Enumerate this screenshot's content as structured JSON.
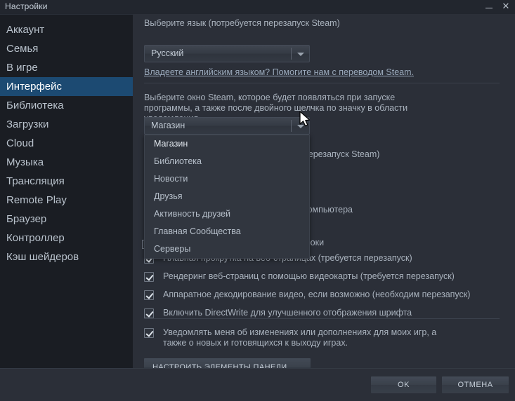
{
  "window": {
    "title": "Настройки",
    "minimize_icon": "minimize-icon",
    "close_icon": "close-icon",
    "close_glyph": "✕"
  },
  "colors": {
    "window_bg": "#2b2f38",
    "sidebar_bg": "#1a1d23",
    "titlebar_bg": "#22262e",
    "selection_blue": "#1c4a72",
    "text": "#a9b2bd",
    "text_bright": "#ffffff",
    "link": "#9aa9bb",
    "divider": "#3b414c"
  },
  "sidebar": {
    "items": [
      {
        "label": "Аккаунт",
        "selected": false
      },
      {
        "label": "Семья",
        "selected": false
      },
      {
        "label": "В игре",
        "selected": false
      },
      {
        "label": "Интерфейс",
        "selected": true
      },
      {
        "label": "Библиотека",
        "selected": false
      },
      {
        "label": "Загрузки",
        "selected": false
      },
      {
        "label": "Cloud",
        "selected": false
      },
      {
        "label": "Музыка",
        "selected": false
      },
      {
        "label": "Трансляция",
        "selected": false
      },
      {
        "label": "Remote Play",
        "selected": false
      },
      {
        "label": "Браузер",
        "selected": false
      },
      {
        "label": "Контроллер",
        "selected": false
      },
      {
        "label": "Кэш шейдеров",
        "selected": false
      }
    ]
  },
  "content": {
    "language_section": {
      "label": "Выберите язык (потребуется перезапуск Steam)",
      "selected_value": "Русский",
      "translation_link": "Владеете английским языком? Помогите нам с переводом Steam."
    },
    "startup_section": {
      "label": "Выберите окно Steam, которое будет появляться при запуске программы, а также после двойного щелчка по значку в области уведомления.",
      "selected_value": "Магазин",
      "options": [
        "Магазин",
        "Библиотека",
        "Новости",
        "Друзья",
        "Активность друзей",
        "Главная Сообщества",
        "Серверы"
      ]
    },
    "occluded_text": {
      "row1": "перезапуск Steam)",
      "row2": "компьютера",
      "row3": "троки"
    },
    "checkboxes": [
      {
        "label": "Плавная прокрутка на веб-страницах (требуется перезапуск)",
        "checked": true
      },
      {
        "label": "Рендеринг веб-страниц с помощью видеокарты (требуется перезапуск)",
        "checked": true
      },
      {
        "label": "Аппаратное декодирование видео, если возможно (необходим перезапуск)",
        "checked": true
      },
      {
        "label": "Включить DirectWrite для улучшенного отображения шрифта",
        "checked": true
      }
    ],
    "notify_checkbox": {
      "label": "Уведомлять меня об изменениях или дополнениях для моих игр, а также о новых и готовящихся к выходу играх.",
      "checked": true
    },
    "taskbar_button": "НАСТРОИТЬ ЭЛЕМЕНТЫ ПАНЕЛИ ЗАДАЧ"
  },
  "footer": {
    "ok": "OK",
    "cancel": "ОТМЕНА"
  }
}
